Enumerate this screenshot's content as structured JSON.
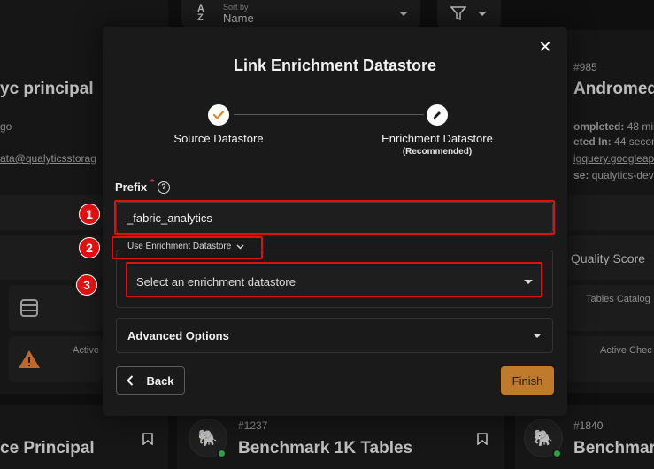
{
  "background": {
    "sort": {
      "caption": "Sort by",
      "value": "Name"
    },
    "left_card": {
      "title": "yc principal",
      "location": "go",
      "email": "ata@qualyticsstorag",
      "bottom_title": "ce Principal"
    },
    "right_card": {
      "id": "#985",
      "title": "Andromed",
      "completed_label": "ompleted:",
      "completed_value": "48 min",
      "duration_label": "eted In:",
      "duration_value": "44 second",
      "host": "igquery.googleapi",
      "database_label": "se:",
      "database_value": "qualytics-dev",
      "quality_score": "Quality Score",
      "tables_cataloged": "Tables Catalog",
      "active_checks": "Active Chec"
    },
    "left_small": {
      "active_label": "Active"
    },
    "bottom_cards": [
      {
        "id": "#1237",
        "title": "Benchmark 1K Tables"
      },
      {
        "id": "#1840",
        "title": "Benchmar"
      }
    ]
  },
  "modal": {
    "title": "Link Enrichment Datastore",
    "close_glyph": "✕",
    "steps": [
      {
        "label": "Source Datastore",
        "sub": ""
      },
      {
        "label": "Enrichment Datastore",
        "sub": "(Recommended)"
      }
    ],
    "prefix": {
      "label": "Prefix",
      "required_mark": "*",
      "help_glyph": "?",
      "value": "_fabric_analytics"
    },
    "enrichment_group": {
      "legend": "Use Enrichment Datastore",
      "select_placeholder": "Select an enrichment datastore"
    },
    "advanced_options": "Advanced Options",
    "back_label": "Back",
    "finish_label": "Finish"
  },
  "annotations": [
    "1",
    "2",
    "3"
  ],
  "colors": {
    "accent": "#bf7a2c",
    "highlight": "#e01010",
    "check": "#d58a2a"
  }
}
